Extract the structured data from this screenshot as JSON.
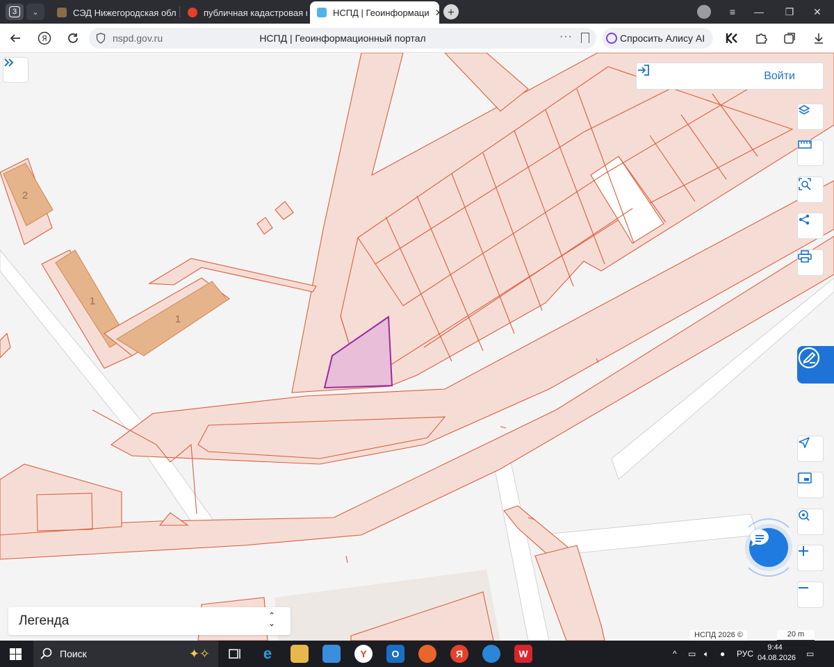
{
  "browser": {
    "tab_counter": "3",
    "tabs": [
      {
        "label": "СЭД Нижегородская обл"
      },
      {
        "label": "публичная кадастровая к"
      },
      {
        "label": "НСПД | Геоинформаци"
      }
    ],
    "url_domain": "nspd.gov.ru",
    "page_title": "НСПД | Геоинформационный портал",
    "alice_label": "Спросить Алису AI"
  },
  "map": {
    "login_label": "Войти",
    "legend_label": "Легенда",
    "copyright": "НСПД 2026 ©",
    "scale_label": "20 m",
    "building_labels": [
      "2",
      "1",
      "1"
    ]
  },
  "taskbar": {
    "search_label": "Поиск",
    "language": "РУС",
    "time": "9:44",
    "date": "04.08.2026"
  }
}
